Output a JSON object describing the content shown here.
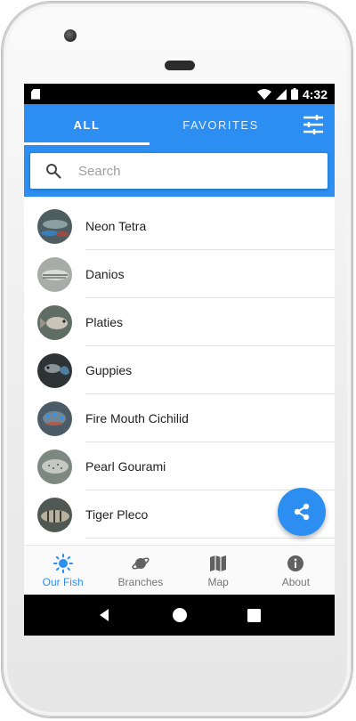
{
  "status_bar": {
    "time": "4:32"
  },
  "tabs": [
    {
      "label": "ALL"
    },
    {
      "label": "FAVORITES"
    }
  ],
  "search": {
    "placeholder": "Search"
  },
  "fish_list": [
    {
      "name": "Neon Tetra",
      "avatar_color": "#5b6a6e"
    },
    {
      "name": "Danios",
      "avatar_color": "#9aa0a0"
    },
    {
      "name": "Platies",
      "avatar_color": "#6f7f75"
    },
    {
      "name": "Guppies",
      "avatar_color": "#3d4548"
    },
    {
      "name": "Fire Mouth Cichilid",
      "avatar_color": "#4f6a7c"
    },
    {
      "name": "Pearl Gourami",
      "avatar_color": "#7f8a84"
    },
    {
      "name": "Tiger Pleco",
      "avatar_color": "#56605a"
    }
  ],
  "bottom_nav": [
    {
      "label": "Our Fish",
      "icon": "sun-icon",
      "active": true
    },
    {
      "label": "Branches",
      "icon": "planet-icon",
      "active": false
    },
    {
      "label": "Map",
      "icon": "map-icon",
      "active": false
    },
    {
      "label": "About",
      "icon": "info-icon",
      "active": false
    }
  ],
  "colors": {
    "primary": "#2b8ef0",
    "inactive": "#757575"
  }
}
